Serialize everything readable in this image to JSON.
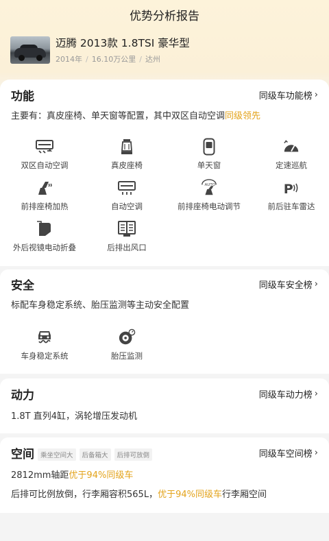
{
  "header": {
    "title": "优势分析报告"
  },
  "car": {
    "name": "迈腾 2013款 1.8TSI 豪华型",
    "year": "2014年",
    "mileage": "16.10万公里",
    "city": "达州"
  },
  "sections": {
    "function": {
      "title": "功能",
      "rank_link": "同级车功能榜",
      "desc_prefix": "主要有：真皮座椅、单天窗等配置，其中双区自动空调",
      "desc_highlight": "同级领先",
      "features": [
        {
          "label": "双区自动空调",
          "icon": "ac-icon"
        },
        {
          "label": "真皮座椅",
          "icon": "seat-icon"
        },
        {
          "label": "单天窗",
          "icon": "sunroof-icon"
        },
        {
          "label": "定速巡航",
          "icon": "cruise-icon"
        },
        {
          "label": "前排座椅加热",
          "icon": "seat-heat-icon"
        },
        {
          "label": "自动空调",
          "icon": "auto-ac-icon"
        },
        {
          "label": "前排座椅电动调节",
          "icon": "seat-adjust-icon"
        },
        {
          "label": "前后驻车雷达",
          "icon": "parking-radar-icon"
        },
        {
          "label": "外后视镜电动折叠",
          "icon": "mirror-fold-icon"
        },
        {
          "label": "后排出风口",
          "icon": "rear-vent-icon"
        }
      ]
    },
    "safety": {
      "title": "安全",
      "rank_link": "同级车安全榜",
      "desc": "标配车身稳定系统、胎压监测等主动安全配置",
      "features": [
        {
          "label": "车身稳定系统",
          "icon": "esp-icon"
        },
        {
          "label": "胎压监测",
          "icon": "tire-pressure-icon"
        }
      ]
    },
    "power": {
      "title": "动力",
      "rank_link": "同级车动力榜",
      "desc": "1.8T 直列4缸，涡轮增压发动机"
    },
    "space": {
      "title": "空间",
      "tags": [
        "乘坐空间大",
        "后备箱大",
        "后排可放倒"
      ],
      "rank_link": "同级车空间榜",
      "line1_prefix": "2812mm轴距",
      "line1_highlight": "优于94%同级车",
      "line2_prefix": "后排可比例放倒，行李厢容积565L，",
      "line2_highlight": "优于94%同级车",
      "line2_suffix": "行李厢空间"
    }
  },
  "colors": {
    "highlight": "#e3a31b",
    "top_gradient": "#fdf3da"
  }
}
